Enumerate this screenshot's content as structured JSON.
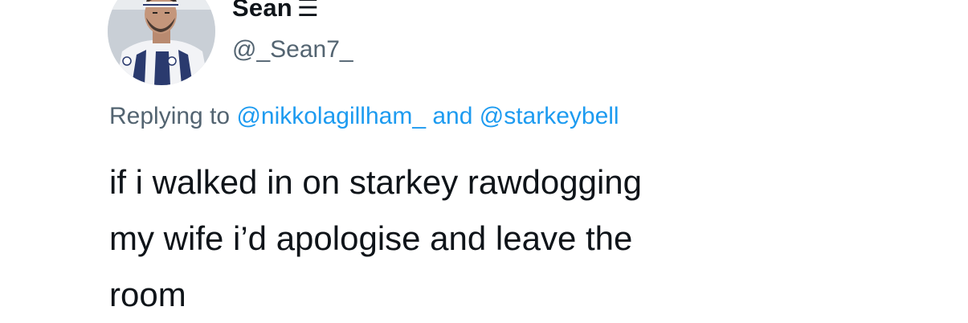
{
  "author": {
    "display_name": "Sean",
    "badge_icon": "three-lines-icon",
    "badge_glyph": "☰",
    "handle": "@_Sean7_"
  },
  "reply": {
    "prefix": "Replying to",
    "mention_1": "@nikkolagillham_",
    "conjunction": "and",
    "mention_2": "@starkeybell"
  },
  "tweet": {
    "line_1": "if i walked in on starkey rawdogging",
    "line_2": "my wife i’d apologise and leave the",
    "line_3": "room"
  },
  "colors": {
    "mention": "#1d9bf0",
    "secondary_text": "#536471",
    "primary_text": "#0f1419"
  }
}
